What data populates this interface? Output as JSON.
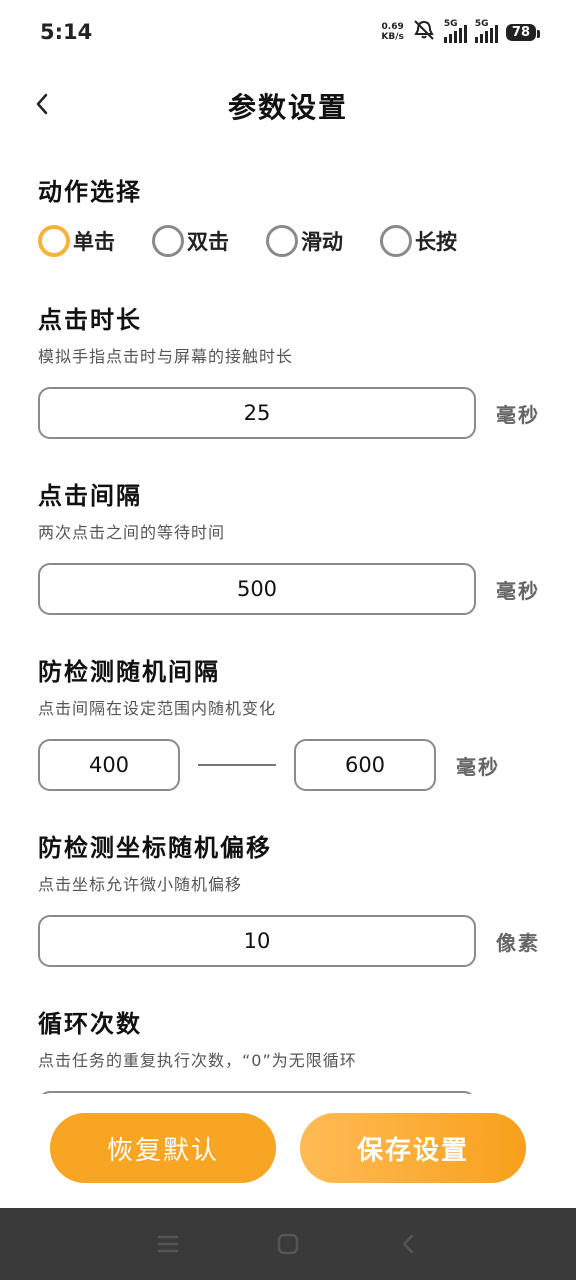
{
  "status_bar": {
    "time": "5:14",
    "speed_value": "0.69",
    "speed_unit": "KB/s",
    "sim1_tag": "5G",
    "sim2_tag": "5G",
    "battery": "78"
  },
  "header": {
    "title": "参数设置"
  },
  "action": {
    "title": "动作选择",
    "options": [
      "单击",
      "双击",
      "滑动",
      "长按"
    ],
    "selected": "单击"
  },
  "click_duration": {
    "title": "点击时长",
    "desc": "模拟手指点击时与屏幕的接触时长",
    "value": "25",
    "unit": "毫秒"
  },
  "click_interval": {
    "title": "点击间隔",
    "desc": "两次点击之间的等待时间",
    "value": "500",
    "unit": "毫秒"
  },
  "random_interval": {
    "title": "防检测随机间隔",
    "desc": "点击间隔在设定范围内随机变化",
    "min": "400",
    "max": "600",
    "unit": "毫秒"
  },
  "random_offset": {
    "title": "防检测坐标随机偏移",
    "desc": "点击坐标允许微小随机偏移",
    "value": "10",
    "unit": "像素"
  },
  "loop_count": {
    "title": "循环次数",
    "desc": "点击任务的重复执行次数，“0”为无限循环"
  },
  "buttons": {
    "reset": "恢复默认",
    "save": "保存设置"
  },
  "colors": {
    "accent": "#f8a523",
    "selected_ring": "#f7b23b",
    "navbar": "#3a3a3a"
  }
}
